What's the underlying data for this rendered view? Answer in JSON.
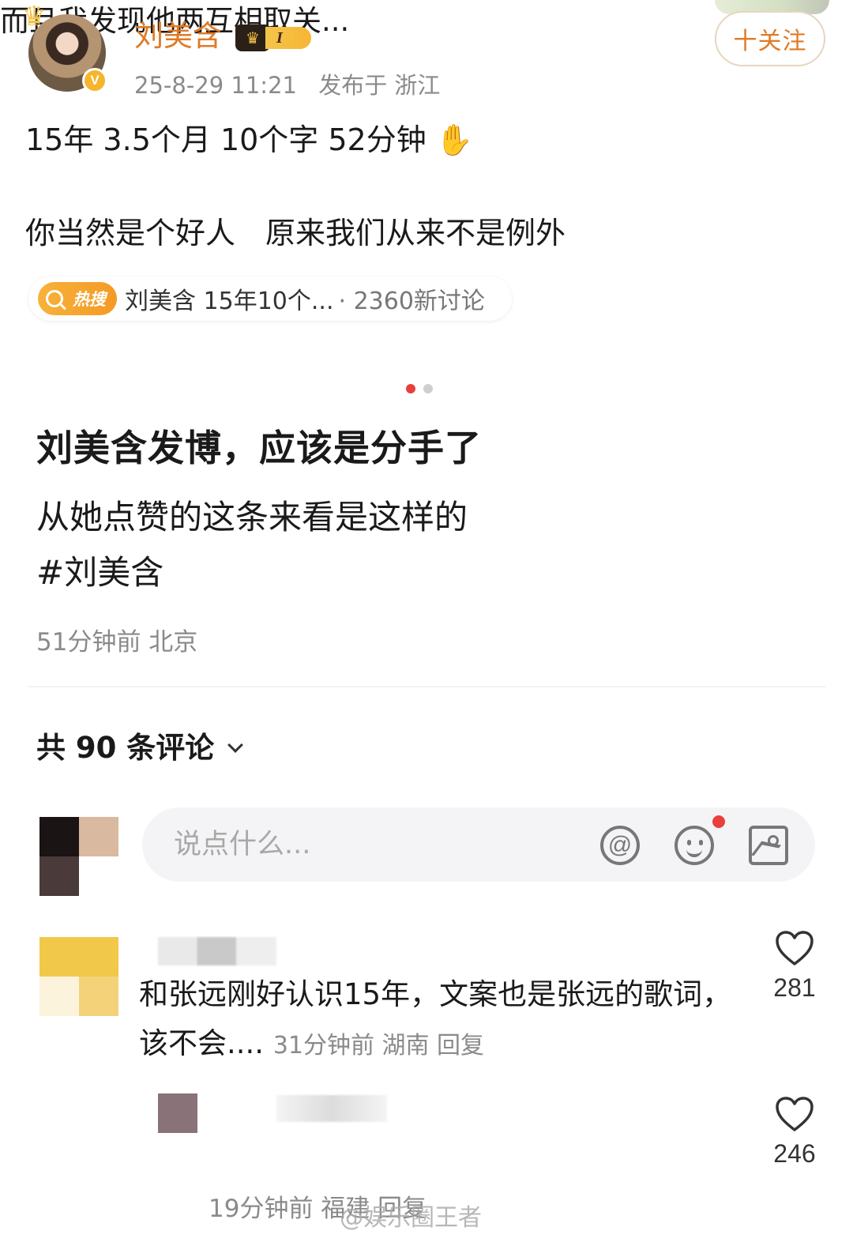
{
  "repost": {
    "username": "刘美含",
    "vip_level": "I",
    "follow_label": "十关注",
    "time": "25-8-29 11:21",
    "location": "发布于 浙江",
    "line1": "15年 3.5个月 10个字 52分钟",
    "line2": "你当然是个好人　原来我们从来不是例外",
    "hot_search": {
      "tag": "热搜",
      "text": "刘美含 15年10个...",
      "count": "· 2360新讨论"
    }
  },
  "pager": {
    "total": 2,
    "active": 0
  },
  "post": {
    "title": "刘美含发博，应该是分手了",
    "body": "从她点赞的这条来看是这样的",
    "tag": "#刘美含",
    "meta": "51分钟前 北京"
  },
  "comments_header": {
    "label": "共 90 条评论"
  },
  "comment_input": {
    "placeholder": "说点什么..."
  },
  "comments": [
    {
      "text": "和张远刚好认识15年，文案也是张远的歌词，该不会....",
      "meta": "31分钟前 湖南 回复",
      "likes": "281"
    },
    {
      "text": "而且我发现他两互相取关...",
      "meta": "19分钟前 福建 回复",
      "likes": "246"
    }
  ],
  "watermark": "@娱乐圈王者",
  "colors": {
    "accent": "#e07a24",
    "active_dot": "#e8403c",
    "muted": "#8a8a8a"
  }
}
